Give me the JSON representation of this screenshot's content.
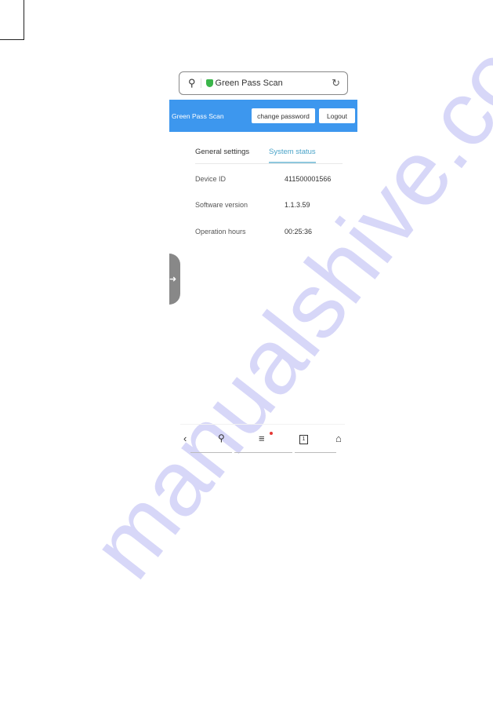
{
  "watermark": "manualshive.com",
  "browser": {
    "url_title": "Green Pass Scan"
  },
  "header": {
    "title": "Green Pass Scan",
    "change_password": "change password",
    "logout": "Logout"
  },
  "tabs": [
    {
      "label": "General settings",
      "active": false
    },
    {
      "label": "System status",
      "active": true
    }
  ],
  "status": [
    {
      "label": "Device ID",
      "value": "411500001566"
    },
    {
      "label": "Software version",
      "value": "1.1.3.59"
    },
    {
      "label": "Operation hours",
      "value": "00:25:36"
    }
  ],
  "navbar": {
    "tabs_count": "1",
    "icons": [
      "back-icon",
      "search-icon",
      "menu-icon",
      "tabs-icon",
      "home-icon"
    ]
  },
  "colors": {
    "header": "#3d97ee",
    "active_tab": "#4aa3c8",
    "shield": "#3ab54a",
    "notification_dot": "#e53935"
  }
}
